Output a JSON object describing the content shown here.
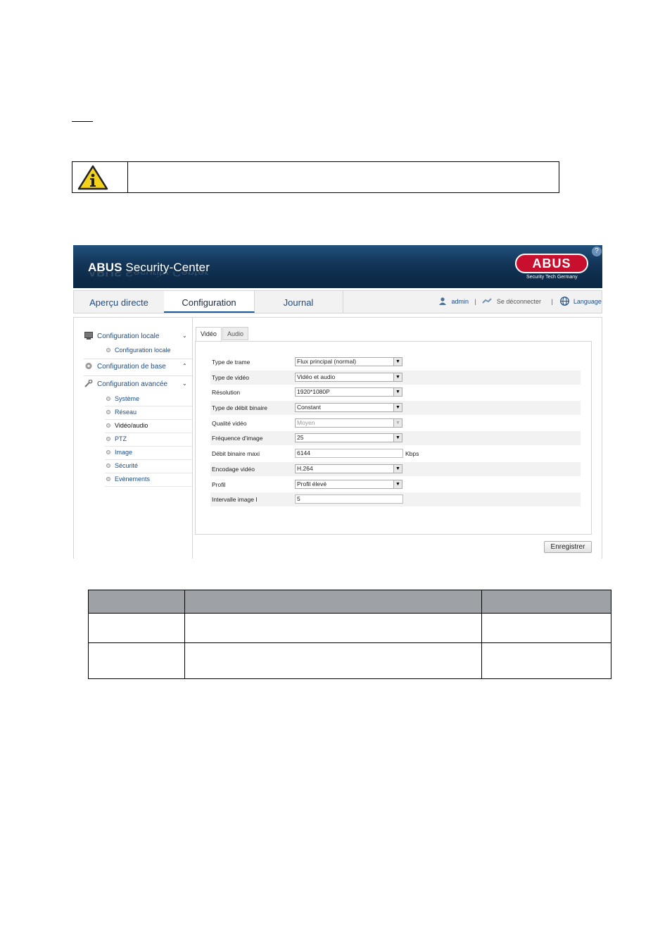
{
  "app": {
    "title_bold": "ABUS",
    "title_rest": " Security-Center",
    "logo_text": "ABUS",
    "logo_tagline": "Security Tech Germany",
    "help_label": "?"
  },
  "nav": {
    "tabs": [
      {
        "label": "Aperçu directe"
      },
      {
        "label": "Configuration"
      },
      {
        "label": "Journal"
      }
    ],
    "user": "admin",
    "separator": "|",
    "logout": "Se déconnecter",
    "language": "Language"
  },
  "sidebar": {
    "sections": [
      {
        "label": "Configuration locale",
        "chevron": "⌄"
      },
      {
        "label": "Configuration de base",
        "chevron": "⌃"
      },
      {
        "label": "Configuration avancée",
        "chevron": "⌄"
      }
    ],
    "local_items": [
      {
        "label": "Configuration locale"
      }
    ],
    "advanced_items": [
      {
        "label": "Système"
      },
      {
        "label": "Réseau"
      },
      {
        "label": "Vidéo/audio"
      },
      {
        "label": "PTZ"
      },
      {
        "label": "Image"
      },
      {
        "label": "Sécurité"
      },
      {
        "label": "Evènements"
      }
    ]
  },
  "subtabs": [
    {
      "label": "Vidéo"
    },
    {
      "label": "Audio"
    }
  ],
  "form": {
    "rows": [
      {
        "label": "Type de trame",
        "value": "Flux principal (normal)"
      },
      {
        "label": "Type de vidéo",
        "value": "Vidéo et audio"
      },
      {
        "label": "Résolution",
        "value": "1920*1080P"
      },
      {
        "label": "Type de débit binaire",
        "value": "Constant"
      },
      {
        "label": "Qualité vidéo",
        "value": "Moyen"
      },
      {
        "label": "Fréquence d'image",
        "value": "25"
      },
      {
        "label": "Débit binaire maxi",
        "value": "6144",
        "unit": "Kbps"
      },
      {
        "label": "Encodage vidéo",
        "value": "H.264"
      },
      {
        "label": "Profil",
        "value": "Profil élevé"
      },
      {
        "label": "Intervalle image I",
        "value": "5"
      }
    ],
    "save_label": "Enregistrer"
  }
}
